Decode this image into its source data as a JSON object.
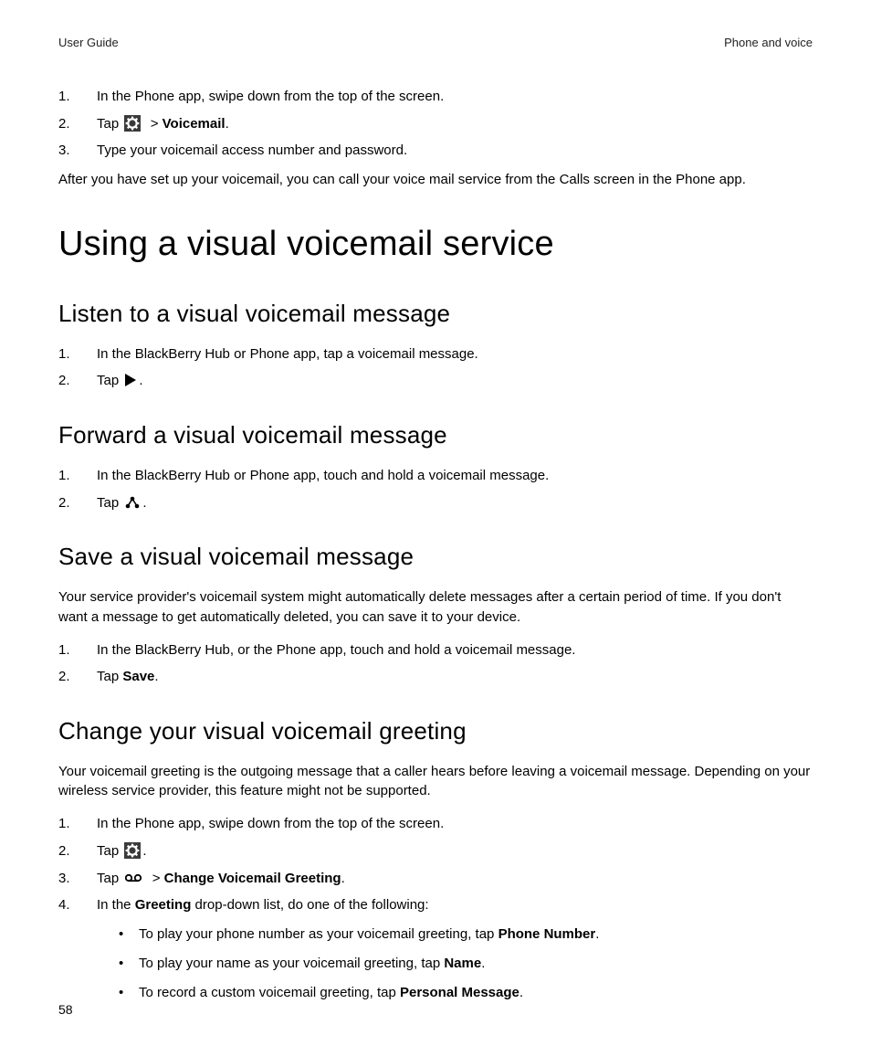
{
  "header": {
    "left": "User Guide",
    "right": "Phone and voice"
  },
  "intro_list": {
    "items": [
      {
        "num": "1.",
        "text": "In the Phone app, swipe down from the top of the screen."
      },
      {
        "num": "2.",
        "tap": "Tap",
        "gt": ">",
        "bold": "Voicemail",
        "after": "."
      },
      {
        "num": "3.",
        "text": "Type your voicemail access number and password."
      }
    ]
  },
  "intro_paragraph": "After you have set up your voicemail, you can call your voice mail service from the Calls screen in the Phone app.",
  "h1": "Using a visual voicemail service",
  "sections": {
    "listen": {
      "title": "Listen to a visual voicemail message",
      "items": [
        {
          "num": "1.",
          "text": "In the BlackBerry Hub or Phone app, tap a voicemail message."
        },
        {
          "num": "2.",
          "tap": "Tap",
          "after": "."
        }
      ]
    },
    "forward": {
      "title": "Forward a visual voicemail message",
      "items": [
        {
          "num": "1.",
          "text": "In the BlackBerry Hub or Phone app, touch and hold a voicemail message."
        },
        {
          "num": "2.",
          "tap": "Tap",
          "after": "."
        }
      ]
    },
    "save": {
      "title": "Save a visual voicemail message",
      "paragraph": "Your service provider's voicemail system might automatically delete messages after a certain period of time. If you don't want a message to get automatically deleted, you can save it to your device.",
      "items": [
        {
          "num": "1.",
          "text": "In the BlackBerry Hub, or the Phone app, touch and hold a voicemail message."
        },
        {
          "num": "2.",
          "tap": "Tap ",
          "bold": "Save",
          "after": "."
        }
      ]
    },
    "change": {
      "title": "Change your visual voicemail greeting",
      "paragraph": "Your voicemail greeting is the outgoing message that a caller hears before leaving a voicemail message. Depending on your wireless service provider, this feature might not be supported.",
      "items": [
        {
          "num": "1.",
          "text": "In the Phone app, swipe down from the top of the screen."
        },
        {
          "num": "2.",
          "tap": "Tap",
          "after": "."
        },
        {
          "num": "3.",
          "tap": "Tap",
          "gt": ">",
          "bold": "Change Voicemail Greeting",
          "after": "."
        },
        {
          "num": "4.",
          "pre": "In the ",
          "bold": "Greeting",
          "post": " drop-down list, do one of the following:"
        }
      ],
      "bullets": [
        {
          "pre": "To play your phone number as your voicemail greeting, tap ",
          "bold": "Phone Number",
          "after": "."
        },
        {
          "pre": "To play your name as your voicemail greeting, tap ",
          "bold": "Name",
          "after": "."
        },
        {
          "pre": "To record a custom voicemail greeting, tap ",
          "bold": "Personal Message",
          "after": "."
        }
      ]
    }
  },
  "page_number": "58"
}
